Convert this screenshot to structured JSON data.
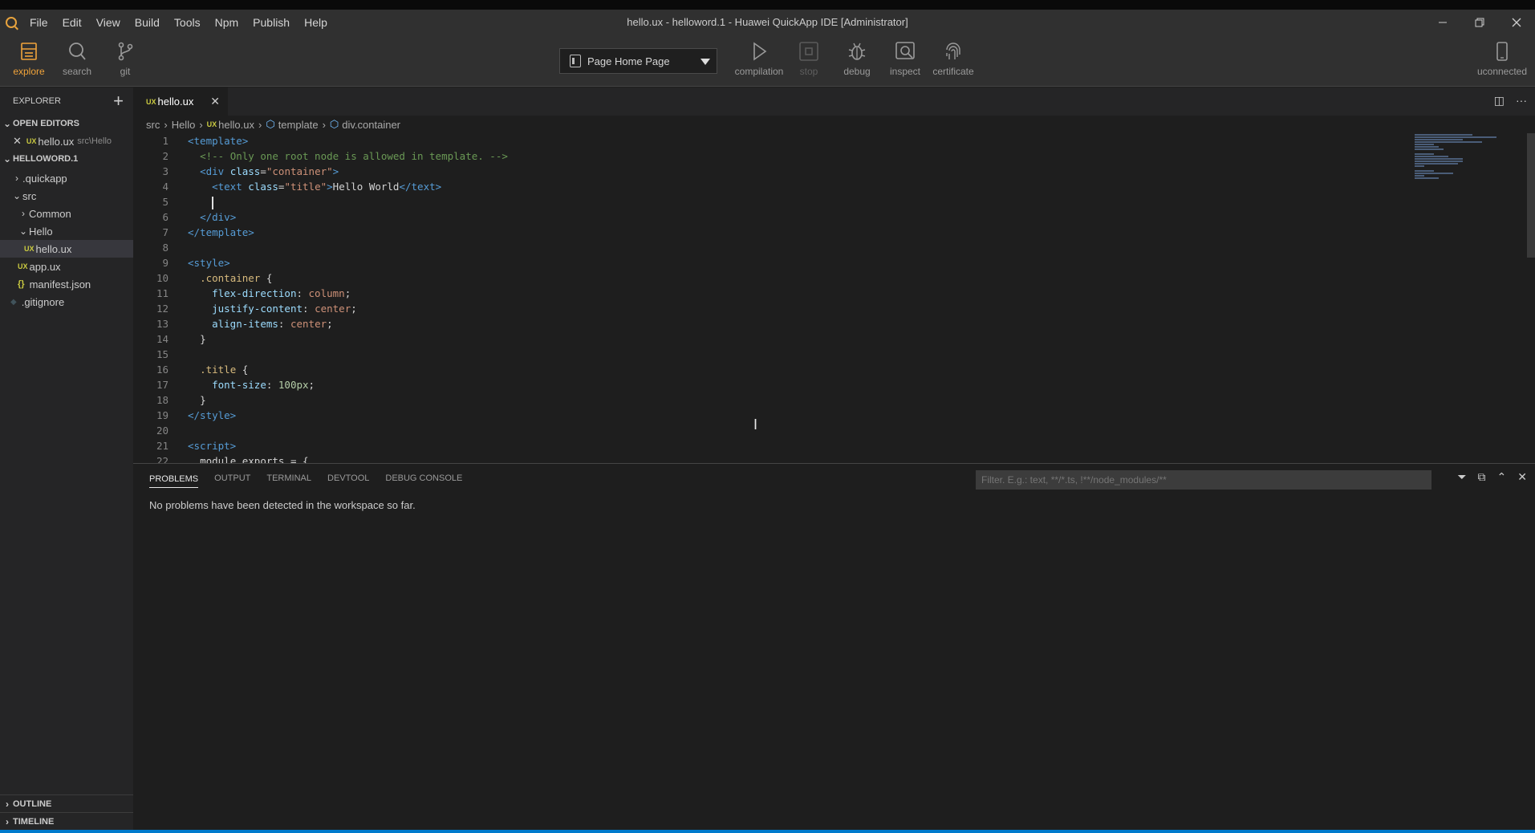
{
  "menubar": {
    "items": [
      "File",
      "Edit",
      "View",
      "Build",
      "Tools",
      "Npm",
      "Publish",
      "Help"
    ],
    "window_title": "hello.ux - helloword.1 - Huawei QuickApp IDE [Administrator]"
  },
  "toolbar": {
    "left_tools": [
      {
        "label": "explore",
        "icon": "explore-icon",
        "active": true
      },
      {
        "label": "search",
        "icon": "search-icon"
      },
      {
        "label": "git",
        "icon": "git-icon"
      }
    ],
    "page_select": "Page Home Page",
    "center_tools": [
      {
        "label": "compilation",
        "icon": "play-icon"
      },
      {
        "label": "stop",
        "icon": "stop-icon"
      },
      {
        "label": "debug",
        "icon": "bug-icon"
      },
      {
        "label": "inspect",
        "icon": "inspect-icon"
      },
      {
        "label": "certificate",
        "icon": "fingerprint-icon"
      }
    ],
    "device_label": "uconnected",
    "accent": "#f0a33a"
  },
  "sidebar": {
    "title": "EXPLORER",
    "open_editors_label": "OPEN EDITORS",
    "open_editor": {
      "badge": "UX",
      "name": "hello.ux",
      "path": "src\\Hello"
    },
    "project_label": "HELLOWORD.1",
    "tree": [
      {
        "label": ".quickapp",
        "type": "folder",
        "expanded": false
      },
      {
        "label": "src",
        "type": "folder",
        "expanded": true
      },
      {
        "label": "Common",
        "type": "folder",
        "expanded": false
      },
      {
        "label": "Hello",
        "type": "folder",
        "expanded": true
      },
      {
        "label": "hello.ux",
        "type": "ux",
        "selected": true
      },
      {
        "label": "app.ux",
        "type": "ux"
      },
      {
        "label": "manifest.json",
        "type": "json"
      },
      {
        "label": ".gitignore",
        "type": "git"
      }
    ],
    "outline_label": "OUTLINE",
    "timeline_label": "TIMELINE"
  },
  "editor": {
    "tab_badge": "UX",
    "tab_label": "hello.ux",
    "breadcrumb": [
      "src",
      "Hello",
      "hello.ux",
      "template",
      "div.container"
    ],
    "breadcrumb_badge": "UX",
    "line_numbers": [
      "1",
      "2",
      "3",
      "4",
      "5",
      "6",
      "7",
      "8",
      "9",
      "10",
      "11",
      "12",
      "13",
      "14",
      "15",
      "16",
      "17",
      "18",
      "19",
      "20",
      "21",
      "22"
    ],
    "code": {
      "l1_tag": "<template>",
      "l2_comment": "<!-- Only one root node is allowed in template. -->",
      "l3_open": "<div",
      "l3_attr": "class",
      "l3_eq": "=",
      "l3_val": "\"container\"",
      "l3_close": ">",
      "l4_open": "<text",
      "l4_attr": "class",
      "l4_eq": "=",
      "l4_val": "\"title\"",
      "l4_gt": ">",
      "l4_text": "Hello World",
      "l4_end": "</text>",
      "l6_end": "</div>",
      "l7_end": "</template>",
      "l9_tag": "<style>",
      "l10_sel": ".container",
      "l10_brace": " {",
      "l11_prop": "flex-direction",
      "l11_val": "column",
      "l12_prop": "justify-content",
      "l12_val": "center",
      "l13_prop": "align-items",
      "l13_val": "center",
      "l14_brace": "}",
      "l16_sel": ".title",
      "l16_brace": " {",
      "l17_prop": "font-size",
      "l17_val": "100px",
      "l18_brace": "}",
      "l19_end": "</style>",
      "l21_tag": "<script>",
      "l22_text": "module.exports = {"
    }
  },
  "panel": {
    "tabs": [
      "PROBLEMS",
      "OUTPUT",
      "TERMINAL",
      "DEVTOOL",
      "DEBUG CONSOLE"
    ],
    "filter_placeholder": "Filter. E.g.: text, **/*.ts, !**/node_modules/**",
    "message": "No problems have been detected in the workspace so far."
  }
}
